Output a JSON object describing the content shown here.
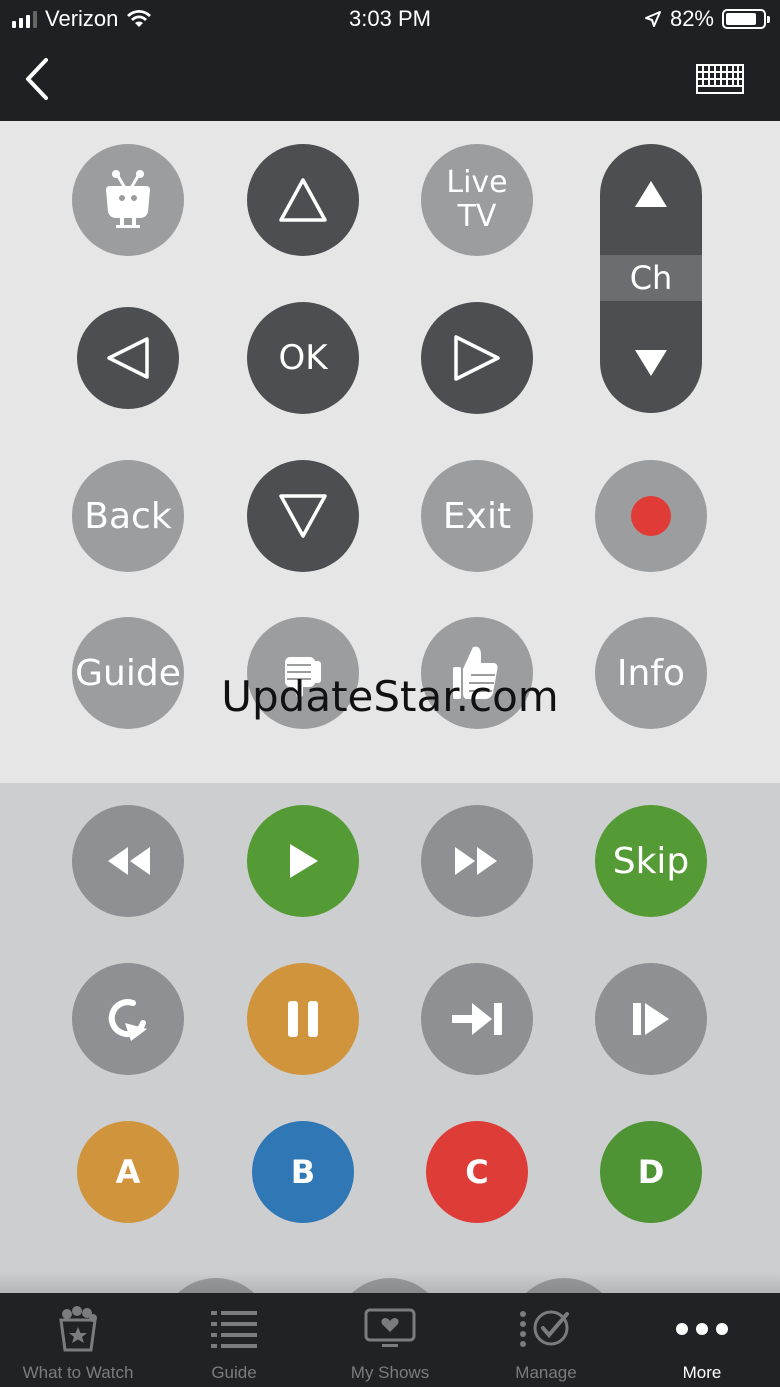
{
  "status_bar": {
    "carrier": "Verizon",
    "time": "3:03 PM",
    "battery": "82%",
    "battery_level": 0.82
  },
  "nav": {
    "back_icon": "chevron-left-icon",
    "keyboard_icon": "keyboard-icon"
  },
  "remote": {
    "tivo_icon": "tivo-logo-icon",
    "up_icon": "triangle-up-icon",
    "live_tv_label_1": "Live",
    "live_tv_label_2": "TV",
    "channel_label": "Ch",
    "left_icon": "triangle-left-icon",
    "ok_label": "OK",
    "right_icon": "triangle-right-icon",
    "back_label": "Back",
    "down_icon": "triangle-down-icon",
    "exit_label": "Exit",
    "record_icon": "record-icon",
    "guide_label": "Guide",
    "thumbs_down_icon": "thumbs-down-icon",
    "thumbs_up_icon": "thumbs-up-icon",
    "info_label": "Info"
  },
  "transport": {
    "rewind_icon": "rewind-icon",
    "play_icon": "play-icon",
    "fast_forward_icon": "fast-forward-icon",
    "skip_label": "Skip",
    "replay_icon": "replay-icon",
    "pause_icon": "pause-icon",
    "advance_icon": "advance-icon",
    "slow_icon": "slow-motion-icon",
    "a_label": "A",
    "b_label": "B",
    "c_label": "C",
    "d_label": "D"
  },
  "watermark": "UpdateStar.com",
  "colors": {
    "play_green": "#559b35",
    "pause_orange": "#d0943c",
    "record_red": "#e03b36",
    "a_orange": "#d0943c",
    "b_blue": "#2f77b5",
    "c_red": "#de3c37",
    "d_green": "#4f9434"
  },
  "tab_bar": {
    "tabs": [
      {
        "label": "What to Watch",
        "icon": "popcorn-star-icon"
      },
      {
        "label": "Guide",
        "icon": "list-icon"
      },
      {
        "label": "My Shows",
        "icon": "tv-heart-icon"
      },
      {
        "label": "Manage",
        "icon": "checklist-icon"
      },
      {
        "label": "More",
        "icon": "more-dots-icon"
      }
    ]
  }
}
